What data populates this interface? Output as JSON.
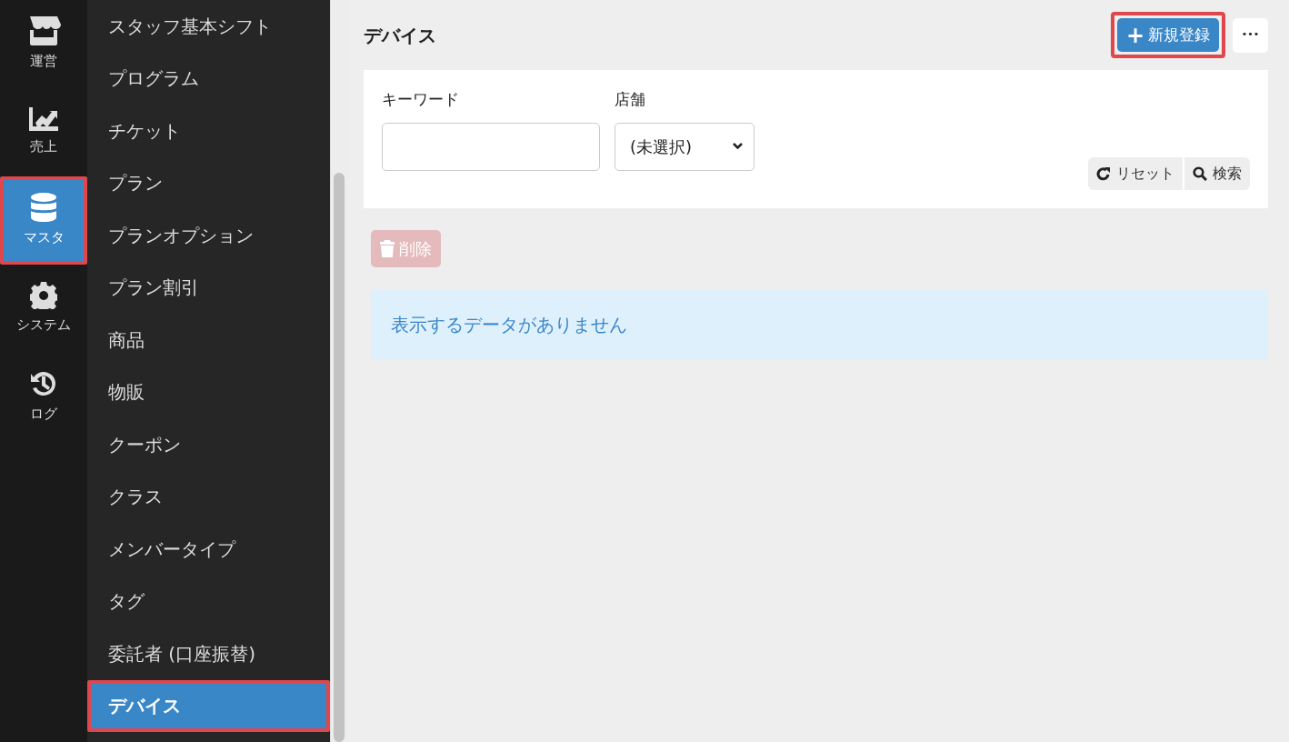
{
  "rail": [
    {
      "label": "運営",
      "selected": false,
      "highlighted": false
    },
    {
      "label": "売上",
      "selected": false,
      "highlighted": false
    },
    {
      "label": "マスタ",
      "selected": true,
      "highlighted": true
    },
    {
      "label": "システム",
      "selected": false,
      "highlighted": false
    },
    {
      "label": "ログ",
      "selected": false,
      "highlighted": false
    }
  ],
  "submenu": [
    {
      "label": "スタッフ基本シフト",
      "selected": false,
      "highlighted": false
    },
    {
      "label": "プログラム",
      "selected": false,
      "highlighted": false
    },
    {
      "label": "チケット",
      "selected": false,
      "highlighted": false
    },
    {
      "label": "プラン",
      "selected": false,
      "highlighted": false
    },
    {
      "label": "プランオプション",
      "selected": false,
      "highlighted": false
    },
    {
      "label": "プラン割引",
      "selected": false,
      "highlighted": false
    },
    {
      "label": "商品",
      "selected": false,
      "highlighted": false
    },
    {
      "label": "物販",
      "selected": false,
      "highlighted": false
    },
    {
      "label": "クーポン",
      "selected": false,
      "highlighted": false
    },
    {
      "label": "クラス",
      "selected": false,
      "highlighted": false
    },
    {
      "label": "メンバータイプ",
      "selected": false,
      "highlighted": false
    },
    {
      "label": "タグ",
      "selected": false,
      "highlighted": false
    },
    {
      "label": "委託者 (口座振替)",
      "selected": false,
      "highlighted": false
    },
    {
      "label": "デバイス",
      "selected": true,
      "highlighted": true
    }
  ],
  "page": {
    "title": "デバイス",
    "new_button": {
      "icon": "+",
      "label": "新規登録",
      "highlighted": true
    },
    "more_button": "•••"
  },
  "filters": {
    "keyword": {
      "label": "キーワード"
    },
    "store": {
      "label": "店舗",
      "value": "(未選択)"
    },
    "reset_button": "リセット",
    "search_button": "検索"
  },
  "delete_button": {
    "label": "削除",
    "disabled": true
  },
  "alert": "表示するデータがありません"
}
